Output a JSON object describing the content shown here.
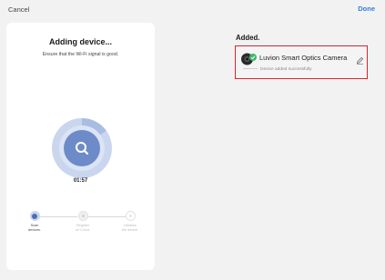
{
  "header": {
    "cancel_label": "Cancel",
    "done_label": "Done"
  },
  "progress_card": {
    "title": "Adding device...",
    "subtitle": "Ensure that the Wi-Fi signal is good.",
    "timer": "01:57",
    "scan_icon": "search-icon",
    "steps": [
      {
        "label_line1": "Scan",
        "label_line2": "devices.",
        "state": "active"
      },
      {
        "label_line1": "Register",
        "label_line2": "on Cloud.",
        "state": "pending"
      },
      {
        "label_line1": "Initialize",
        "label_line2": "the device.",
        "state": "pending"
      }
    ]
  },
  "added_section": {
    "title": "Added.",
    "device": {
      "name": "Luvion Smart Optics Camera",
      "status": "Device added successfully",
      "icon": "camera-icon",
      "badge_icon": "check-icon",
      "edit_icon": "pencil-icon"
    }
  },
  "colors": {
    "accent_blue": "#2f7de1",
    "ring_light": "#c9d6ee",
    "ring_mid": "#a9bde3",
    "ring_core": "#6d8bc8",
    "highlight_border": "#d9232d",
    "success_green": "#3cb76a"
  }
}
